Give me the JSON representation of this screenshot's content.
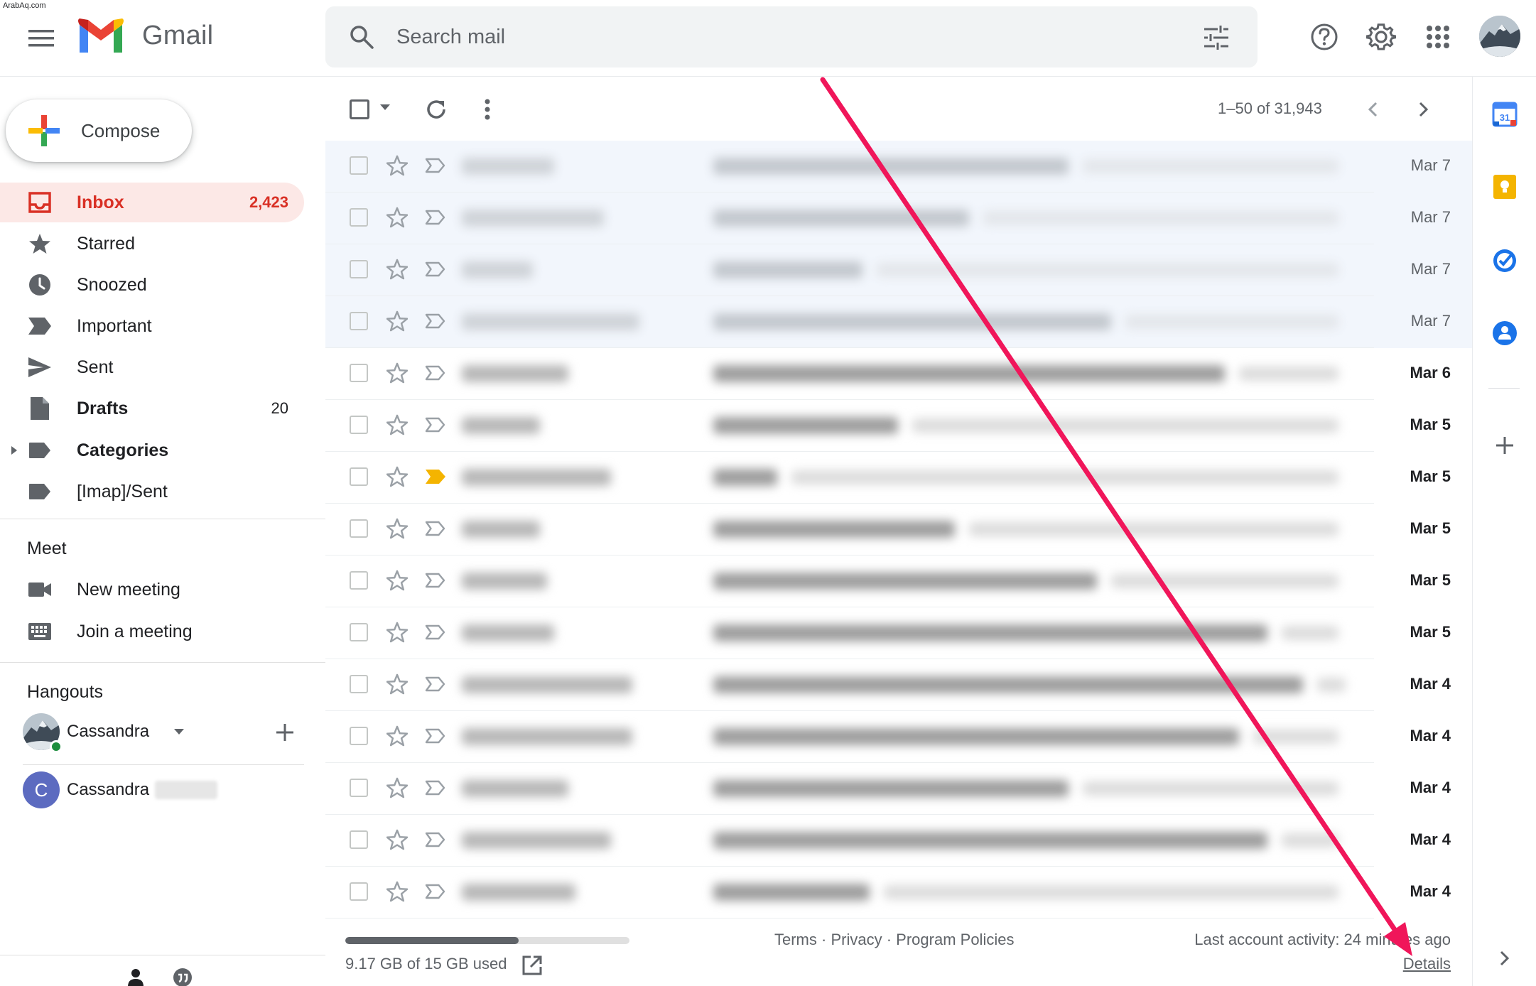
{
  "watermark": "ArabAq.com",
  "app": {
    "name": "Gmail"
  },
  "search": {
    "placeholder": "Search mail"
  },
  "compose": {
    "label": "Compose"
  },
  "nav": {
    "inbox": {
      "label": "Inbox",
      "count": "2,423"
    },
    "starred": {
      "label": "Starred"
    },
    "snoozed": {
      "label": "Snoozed"
    },
    "important": {
      "label": "Important"
    },
    "sent": {
      "label": "Sent"
    },
    "drafts": {
      "label": "Drafts",
      "count": "20"
    },
    "categories": {
      "label": "Categories"
    },
    "imap_sent": {
      "label": "[Imap]/Sent"
    }
  },
  "meet": {
    "title": "Meet",
    "new_meeting": "New meeting",
    "join_meeting": "Join a meeting"
  },
  "hangouts": {
    "title": "Hangouts",
    "self_name": "Cassandra",
    "contact_initial": "C",
    "contact_name": "Cassandra"
  },
  "toolbar": {
    "pagination": "1–50 of 31,943"
  },
  "rows": [
    {
      "date": "Mar 7",
      "read": true,
      "important": false
    },
    {
      "date": "Mar 7",
      "read": true,
      "important": false
    },
    {
      "date": "Mar 7",
      "read": true,
      "important": false
    },
    {
      "date": "Mar 7",
      "read": true,
      "important": false
    },
    {
      "date": "Mar 6",
      "read": false,
      "important": false
    },
    {
      "date": "Mar 5",
      "read": false,
      "important": false
    },
    {
      "date": "Mar 5",
      "read": false,
      "important": true
    },
    {
      "date": "Mar 5",
      "read": false,
      "important": false
    },
    {
      "date": "Mar 5",
      "read": false,
      "important": false
    },
    {
      "date": "Mar 5",
      "read": false,
      "important": false
    },
    {
      "date": "Mar 4",
      "read": false,
      "important": false
    },
    {
      "date": "Mar 4",
      "read": false,
      "important": false
    },
    {
      "date": "Mar 4",
      "read": false,
      "important": false
    },
    {
      "date": "Mar 4",
      "read": false,
      "important": false
    },
    {
      "date": "Mar 4",
      "read": false,
      "important": false
    }
  ],
  "footer": {
    "storage_used_fraction": 0.61,
    "storage_text": "9.17 GB of 15 GB used",
    "terms": "Terms",
    "privacy": "Privacy",
    "program_policies": "Program Policies",
    "separator": "·",
    "last_activity": "Last account activity: 24 minutes ago",
    "details": "Details"
  },
  "side_panel": {
    "calendar_day": "31"
  },
  "colors": {
    "accent_red": "#d93025",
    "inbox_bg": "#fce8e6",
    "annotation_arrow": "#f0165a",
    "important_marker": "#f4b400"
  }
}
